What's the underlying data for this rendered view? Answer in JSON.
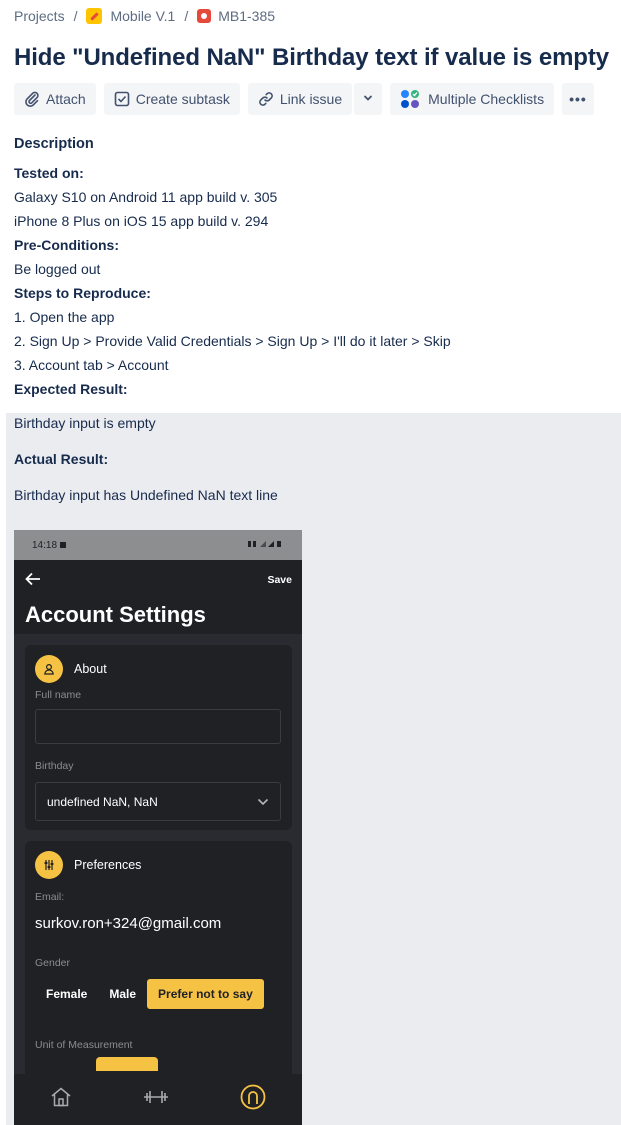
{
  "breadcrumb": {
    "projects": "Projects",
    "separator": "/",
    "project": "Mobile V.1",
    "issue_key": "MB1-385"
  },
  "title": "Hide \"Undefined NaN\" Birthday text if value is empty",
  "toolbar": {
    "attach": "Attach",
    "create_subtask": "Create subtask",
    "link_issue": "Link issue",
    "multiple_checklists": "Multiple Checklists",
    "more": "•••"
  },
  "description": {
    "label": "Description",
    "tested_on_label": "Tested on:",
    "tested_on_1": "Galaxy S10 on Android 11 app build v. 305",
    "tested_on_2": "iPhone 8 Plus on iOS 15 app build v. 294",
    "preconditions_label": "Pre-Conditions:",
    "preconditions": "Be logged out",
    "steps_label": "Steps to Reproduce:",
    "step_1": "1. Open the app",
    "step_2": "2. Sign Up > Provide Valid Credentials > Sign Up > I'll do it later > Skip",
    "step_3": "3. Account tab > Account",
    "expected_label": "Expected Result:",
    "expected": "Birthday input is empty",
    "actual_label": "Actual Result:",
    "actual": "Birthday input has Undefined NaN text line"
  },
  "phone": {
    "time": "14:18",
    "save": "Save",
    "page_title": "Account Settings",
    "about": {
      "heading": "About",
      "full_name_label": "Full name",
      "full_name_value": "",
      "birthday_label": "Birthday",
      "birthday_value": "undefined NaN, NaN"
    },
    "preferences": {
      "heading": "Preferences",
      "email_label": "Email:",
      "email_value": "surkov.ron+324@gmail.com",
      "gender_label": "Gender",
      "gender_options": [
        "Female",
        "Male",
        "Prefer not to say"
      ],
      "gender_selected": "Prefer not to say",
      "unit_label": "Unit of Measurement"
    },
    "colors": {
      "accent": "#f6c244",
      "background": "#1f2125",
      "surface": "#292b30"
    }
  }
}
